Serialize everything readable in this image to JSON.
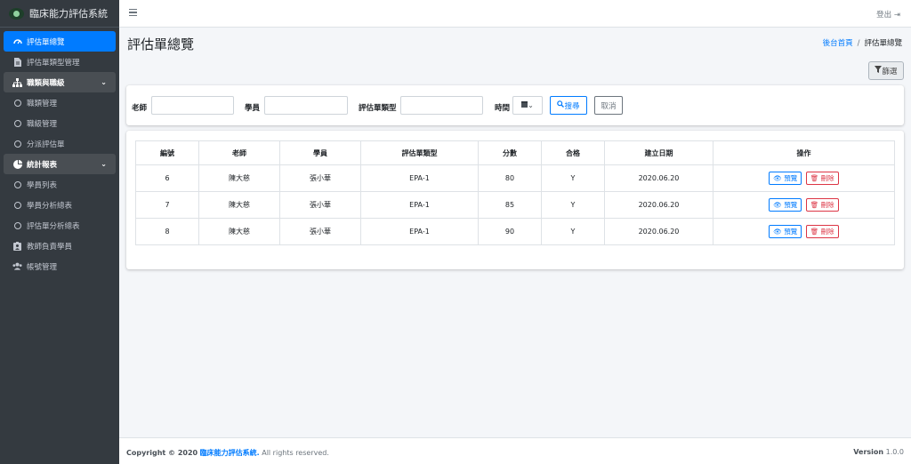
{
  "app": {
    "title": "臨床能力評估系統"
  },
  "sidebar": {
    "items": [
      {
        "label": "評估單總覽",
        "icon": "dashboard-icon"
      },
      {
        "label": "評估單類型管理",
        "icon": "file-icon"
      },
      {
        "label": "職類與職級",
        "icon": "sitemap-icon"
      },
      {
        "label": "職類管理",
        "icon": "circle-icon"
      },
      {
        "label": "職級管理",
        "icon": "circle-icon"
      },
      {
        "label": "分派評估單",
        "icon": "circle-icon"
      },
      {
        "label": "統計報表",
        "icon": "pie-chart-icon"
      },
      {
        "label": "學員列表",
        "icon": "circle-icon"
      },
      {
        "label": "學員分析總表",
        "icon": "circle-icon"
      },
      {
        "label": "評估單分析總表",
        "icon": "circle-icon"
      },
      {
        "label": "教師負責學員",
        "icon": "clipboard-user-icon"
      },
      {
        "label": "帳號管理",
        "icon": "users-icon"
      }
    ]
  },
  "header": {
    "logout_label": "登出"
  },
  "page": {
    "title": "評估單總覽",
    "breadcrumb": {
      "home": "後台首頁",
      "current": "評估單總覽"
    },
    "filter_label": "篩選"
  },
  "search": {
    "teacher_label": "老師",
    "student_label": "學員",
    "type_label": "評估單類型",
    "time_label": "時間",
    "search_label": "搜尋",
    "cancel_label": "取消"
  },
  "table": {
    "headers": [
      "編號",
      "老師",
      "學員",
      "評估單類型",
      "分數",
      "合格",
      "建立日期",
      "操作"
    ],
    "rows": [
      {
        "id": "6",
        "teacher": "陳大慈",
        "student": "張小華",
        "type": "EPA-1",
        "score": "80",
        "pass": "Y",
        "date": "2020.06.20"
      },
      {
        "id": "7",
        "teacher": "陳大慈",
        "student": "張小華",
        "type": "EPA-1",
        "score": "85",
        "pass": "Y",
        "date": "2020.06.20"
      },
      {
        "id": "8",
        "teacher": "陳大慈",
        "student": "張小華",
        "type": "EPA-1",
        "score": "90",
        "pass": "Y",
        "date": "2020.06.20"
      }
    ],
    "view_label": "預覽",
    "delete_label": "刪除"
  },
  "footer": {
    "copyright_prefix": "Copyright © 2020",
    "brand": "臨床能力評估系統.",
    "rights": "All rights reserved.",
    "version_label": "Version",
    "version_value": "1.0.0"
  },
  "colors": {
    "sidebar_bg": "#343a40",
    "accent": "#007bff",
    "danger": "#dc3545"
  }
}
